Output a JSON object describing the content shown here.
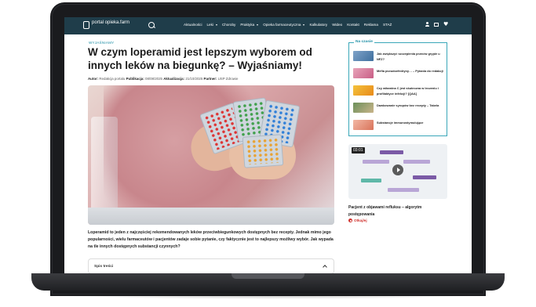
{
  "header": {
    "logo_text": "portal opieka.farm",
    "nav": [
      {
        "label": "Aktualności",
        "dropdown": false
      },
      {
        "label": "Leki",
        "dropdown": true
      },
      {
        "label": "Choroby",
        "dropdown": false
      },
      {
        "label": "Praktyka",
        "dropdown": true
      },
      {
        "label": "Opieka farmaceutyczna",
        "dropdown": true
      },
      {
        "label": "Kalkulatory",
        "dropdown": false
      },
      {
        "label": "Wideo",
        "dropdown": false
      },
      {
        "label": "Kontakt",
        "dropdown": false
      },
      {
        "label": "Reklama",
        "dropdown": false
      },
      {
        "label": "STAŻ",
        "dropdown": false
      }
    ],
    "colors": {
      "bar": "#1f3d4a",
      "accent": "#1f8fa6"
    }
  },
  "article": {
    "category": "WYJAŚNIAMY",
    "title": "W czym loperamid jest lepszym wyborem od innych leków na biegunkę? – Wyjaśniamy!",
    "meta": {
      "author_label": "Autor:",
      "author": "Redakcja portalu",
      "published_label": "Publikacja:",
      "published": "08/08/2025",
      "updated_label": "Aktualizacja:",
      "updated": "21/10/2025",
      "partner_label": "Partner:",
      "partner": "USP Zdrowie"
    },
    "lead": "Loperamid to jeden z najczęściej rekomendowanych leków przeciwbiegunkowych dostępnych bez recepty. Jednak mimo jego popularności, wielu farmaceutów i pacjentów zadaje sobie pytanie, czy faktycznie jest to najlepszy możliwy wybór. Jak wypada na tle innych dostępnych substancji czynnych?",
    "toc_label": "Spis treści"
  },
  "sidebar": {
    "title": "Na czasie",
    "items": [
      {
        "text": "Jak zwiększyć szczepienia przeciw grypie u NFZ?"
      },
      {
        "text": "Mefia pseudoefedryny… – Pytania do redakcji"
      },
      {
        "text": "Czy witamina C jest skuteczna w leczeniu i profilaktyce infekcji? [Q&A]"
      },
      {
        "text": "Dawkowanie syropów bez recepty – Tabela"
      },
      {
        "text": "Substancje immunostymulujące"
      }
    ],
    "video": {
      "duration": "03:01",
      "title": "Pacjent z objawami refluksu – algorytm postępowania",
      "lock_label": "Otkaj/ej"
    }
  }
}
